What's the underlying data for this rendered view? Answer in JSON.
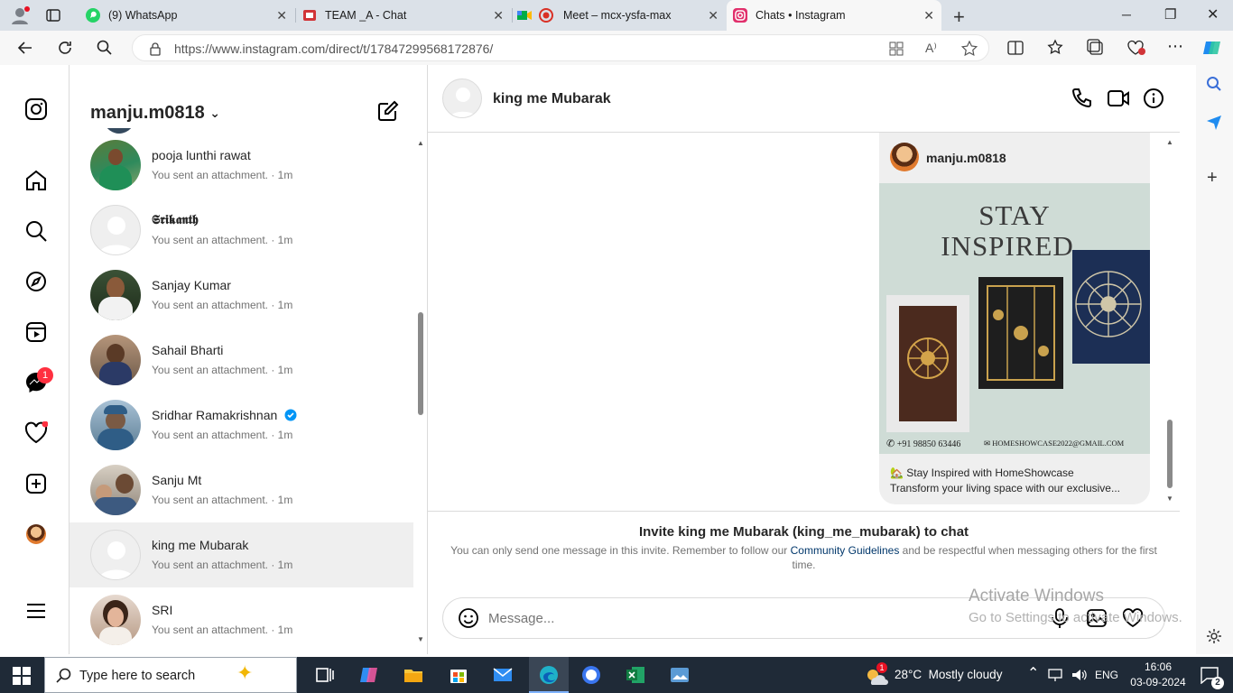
{
  "browser": {
    "tabs": [
      {
        "title": "(9) WhatsApp",
        "active": false
      },
      {
        "title": "TEAM _A - Chat",
        "active": false
      },
      {
        "title": "Meet – mcx-ysfa-max",
        "active": false
      },
      {
        "title": "Chats • Instagram",
        "active": true
      }
    ],
    "url": "https://www.instagram.com/direct/t/17847299568172876/"
  },
  "rail": {
    "notification_count": "1"
  },
  "inbox": {
    "username": "manju.m0818",
    "conversations": [
      {
        "name": "pooja lunthi rawat",
        "preview": "You sent an attachment. · 1m",
        "avatar": "photo"
      },
      {
        "name": "𝕾𝖗𝖎𝖐𝖆𝖓𝖙𝖍",
        "preview": "You sent an attachment. · 1m",
        "avatar": "default"
      },
      {
        "name": "Sanjay Kumar",
        "preview": "You sent an attachment. · 1m",
        "avatar": "photo"
      },
      {
        "name": "Sahail Bharti",
        "preview": "You sent an attachment. · 1m",
        "avatar": "photo"
      },
      {
        "name": "Sridhar Ramakrishnan",
        "preview": "You sent an attachment. · 1m",
        "avatar": "photo",
        "verified": true
      },
      {
        "name": "Sanju Mt",
        "preview": "You sent an attachment. · 1m",
        "avatar": "photo"
      },
      {
        "name": "king me Mubarak",
        "preview": "You sent an attachment. · 1m",
        "avatar": "default",
        "selected": true
      },
      {
        "name": "SRI",
        "preview": "You sent an attachment. · 1m",
        "avatar": "photo"
      }
    ]
  },
  "chat": {
    "contact_name": "king me Mubarak",
    "shared_post": {
      "author": "manju.m0818",
      "image_text_line1": "STAY",
      "image_text_line2": "INSPIRED",
      "phone": "+91 98850 63446",
      "email": "HOMESHOWCASE2022@GMAIL.COM",
      "caption_line1": "🏡 Stay Inspired with HomeShowcase",
      "caption_line2": "Transform your living space with our exclusive..."
    },
    "invite_title": "Invite king me Mubarak (king_me_mubarak) to chat",
    "invite_body_before": "You can only send one message in this invite. Remember to follow our ",
    "invite_link": "Community Guidelines",
    "invite_body_after": " and be respectful when messaging others for the first time.",
    "message_placeholder": "Message..."
  },
  "watermark": {
    "line1": "Activate Windows",
    "line2": "Go to Settings to activate Windows."
  },
  "taskbar": {
    "search_placeholder": "Type here to search",
    "weather": "28°C  Mostly cloudy",
    "weather_badge": "1",
    "language": "ENG",
    "time": "16:06",
    "date": "03-09-2024",
    "notification_count": "2"
  },
  "colors": {
    "instagram_link": "#00376b",
    "verified": "#0095f6",
    "notification_red": "#ff3040",
    "taskbar": "#1f2a37"
  }
}
